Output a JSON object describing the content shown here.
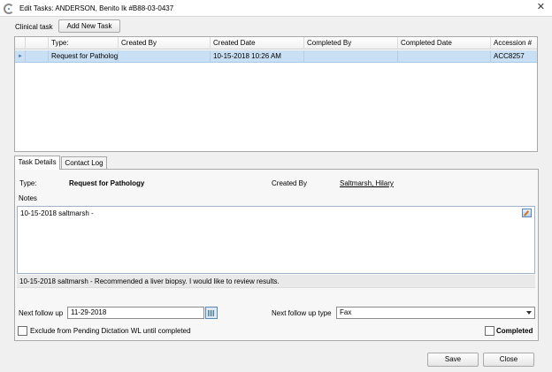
{
  "window": {
    "title": "Edit Tasks: ANDERSON,  Benito Ik #B88-03-0437",
    "close_glyph": "✕"
  },
  "clinical": {
    "label": "Clinical task",
    "add_button": "Add New Task"
  },
  "grid": {
    "columns": [
      "",
      "Type:",
      "Created By",
      "Created Date",
      "Completed By",
      "Completed Date",
      "Accession #"
    ],
    "rows": [
      {
        "pointer": "►",
        "type": "Request for Pathology",
        "created_by": "",
        "created_date": "10-15-2018 10:26 AM",
        "completed_by": "",
        "completed_date": "",
        "accession": "ACC8257"
      }
    ]
  },
  "tabs": [
    "Task Details",
    "Contact Log"
  ],
  "details": {
    "type_label": "Type:",
    "type_value": "Request for Pathology",
    "created_by_label": "Created By",
    "created_by_value": "Saltmarsh, Hilary",
    "notes_label": "Notes",
    "notes_entry": "10-15-2018 saltmarsh -",
    "notes_history": "10-15-2018 saltmarsh - Recommended a liver biopsy. I would like to review results.",
    "next_follow_up_label": "Next follow up",
    "next_follow_up_value": "11-29-2018",
    "next_follow_up_type_label": "Next follow up type",
    "next_follow_up_type_value": "Fax",
    "exclude_label": "Exclude from Pending Dictation WL until completed",
    "exclude_checked": false,
    "completed_label": "Completed",
    "completed_checked": false
  },
  "footer": {
    "save": "Save",
    "close": "Close"
  },
  "icons": {
    "app": "app-logo-icon",
    "edit_notes": "edit-note-icon",
    "calendar": "calendar-icon",
    "dropdown": "chevron-down-icon"
  },
  "colors": {
    "selected_row": "#c9dff3",
    "window_bg": "#f0f0f0",
    "panel_bg": "#f7f7f7"
  }
}
